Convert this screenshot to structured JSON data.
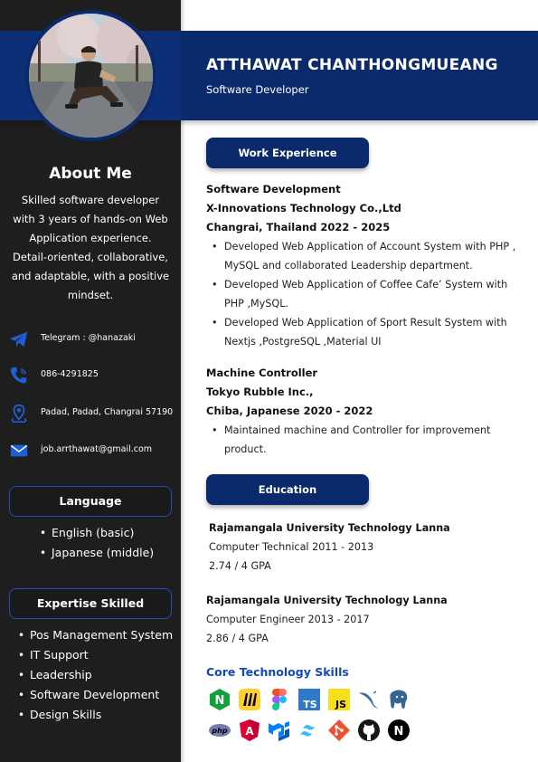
{
  "header": {
    "name": "ATTHAWAT CHANTHONGMUEANG",
    "role": "Software Developer"
  },
  "sidebar": {
    "about_title": "About Me",
    "about_text": "Skilled software developer with 3 years of hands-on Web Application experience. Detail-oriented, collaborative, and adaptable, with a positive mindset.",
    "contacts": [
      {
        "icon": "telegram-icon",
        "text": "Telegram : @hanazaki"
      },
      {
        "icon": "phone-icon",
        "text": "086-4291825"
      },
      {
        "icon": "location-icon",
        "text": "Padad, Padad, Changrai 57190"
      },
      {
        "icon": "email-icon",
        "text": "job.arrthawat@gmail.com"
      }
    ],
    "language_title": "Language",
    "languages": [
      "English (basic)",
      "Japanese (middle)"
    ],
    "expertise_title": "Expertise Skilled",
    "expertise": [
      "Pos Management System",
      "IT Support",
      "Leadership",
      "Software Development",
      "Design Skills"
    ]
  },
  "work": {
    "title": "Work Experience",
    "jobs": [
      {
        "line1": "Software Development",
        "line2": "X-Innovations Technology Co.,Ltd",
        "line3": "Changrai, Thailand 2022 - 2025",
        "bullets": [
          "Developed Web Application of Account System with PHP , MySQL and collaborated Leadership department.",
          "Developed Web Application of Coffee Cafe’ System with PHP ,MySQL.",
          "Developed Web Application of Sport Result System with Nextjs ,PostgreSQL ,Material UI"
        ]
      },
      {
        "line1": "Machine Controller",
        "line2": "Tokyo Rubble Inc.,",
        "line3": "Chiba, Japanese 2020 - 2022",
        "bullets": [
          "Maintained machine and Controller for improvement product."
        ]
      }
    ]
  },
  "education": {
    "title": "Education",
    "items": [
      {
        "school": "Rajamangala University Technology Lanna",
        "course": "Computer Technical 2011 - 2013",
        "gpa": "2.74 / 4 GPA"
      },
      {
        "school": "Rajamangala University Technology Lanna",
        "course": "Computer Engineer 2013 - 2017",
        "gpa": "2.86 / 4 GPA"
      }
    ]
  },
  "skills": {
    "title": "Core Technology Skills",
    "icons": [
      "nginx-icon",
      "miro-icon",
      "figma-icon",
      "typescript-icon",
      "javascript-icon",
      "mysql-icon",
      "postgresql-icon",
      "php-icon",
      "angular-icon",
      "mui-icon",
      "tailwind-icon",
      "git-icon",
      "github-icon",
      "nextjs-icon"
    ],
    "labels": {
      "ts": "TS",
      "js": "JS",
      "php": "php",
      "angular": "A",
      "next": "N",
      "nginx": "N"
    }
  },
  "colors": {
    "navy": "#0b2a6c",
    "sidebar": "#1e1e1e",
    "accent_blue": "#1448b5",
    "icon_blue": "#1f5fd6"
  }
}
